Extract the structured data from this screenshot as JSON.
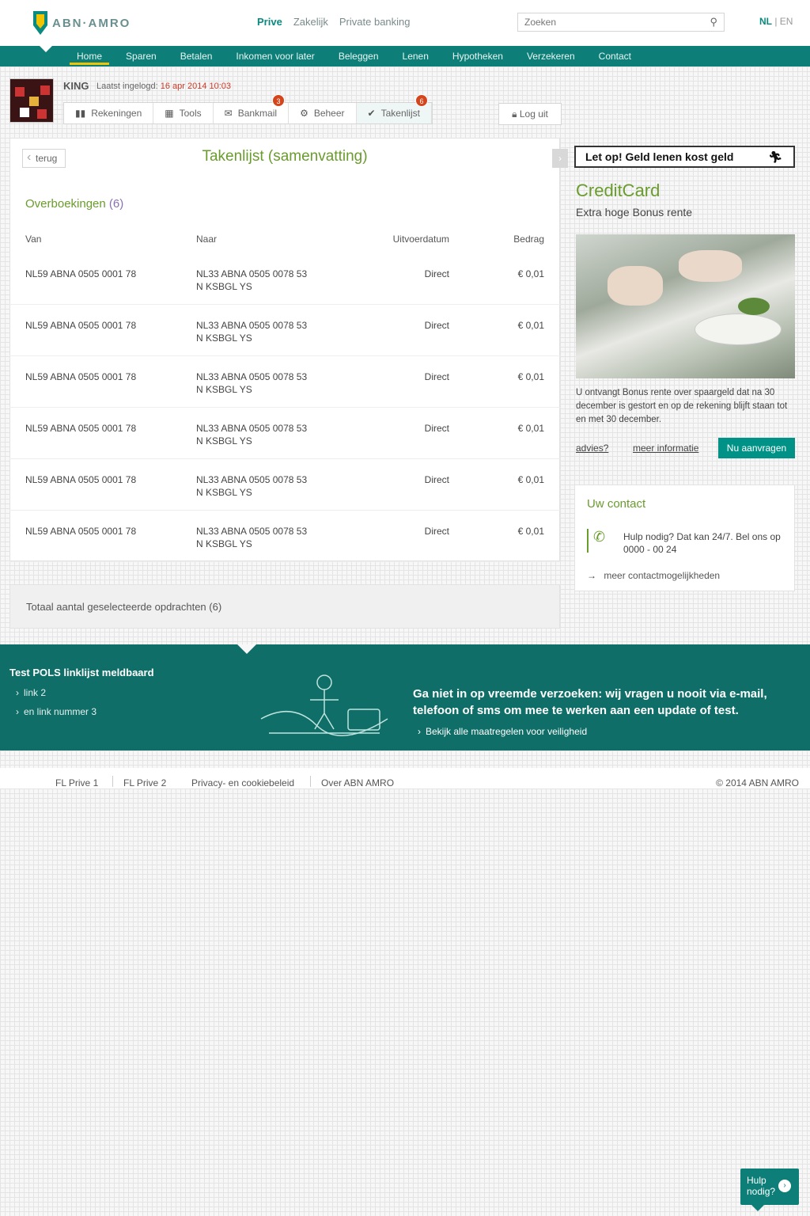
{
  "header": {
    "brand": "ABN·AMRO",
    "segments": [
      {
        "label": "Prive",
        "active": true
      },
      {
        "label": "Zakelijk",
        "active": false
      },
      {
        "label": "Private banking",
        "active": false
      }
    ],
    "search_placeholder": "Zoeken",
    "lang_active": "NL",
    "lang_other": "EN"
  },
  "mainnav": {
    "items": [
      "Home",
      "Sparen",
      "Betalen",
      "Inkomen voor later",
      "Beleggen",
      "Lenen",
      "Hypotheken",
      "Verzekeren",
      "Contact"
    ],
    "active_index": 0
  },
  "user": {
    "name": "KING",
    "last_login_label": "Laatst ingelogd:",
    "last_login_date": "16 apr 2014",
    "last_login_time": "10:03"
  },
  "tabs": [
    {
      "label": "Rekeningen",
      "icon": "bar-chart-icon",
      "glyph": "▮▮"
    },
    {
      "label": "Tools",
      "icon": "grid-icon",
      "glyph": "▦"
    },
    {
      "label": "Bankmail",
      "icon": "mail-icon",
      "glyph": "✉",
      "badge": "3"
    },
    {
      "label": "Beheer",
      "icon": "settings-icon",
      "glyph": "⚙"
    },
    {
      "label": "Takenlijst",
      "icon": "check-icon",
      "glyph": "✔",
      "badge": "6",
      "active": true
    }
  ],
  "logout": "Log uit",
  "content": {
    "back": "terug",
    "title": "Takenlijst (samenvatting)",
    "section": "Overboekingen",
    "section_count": "(6)",
    "columns": {
      "from": "Van",
      "to": "Naar",
      "date": "Uitvoerdatum",
      "amount": "Bedrag"
    },
    "rows": [
      {
        "from": "NL59 ABNA 0505 0001 78",
        "to": "NL33 ABNA 0505 0078 53",
        "to_name": "N KSBGL YS",
        "date": "Direct",
        "amount": "€ 0,01"
      },
      {
        "from": "NL59 ABNA 0505 0001 78",
        "to": "NL33 ABNA 0505 0078 53",
        "to_name": "N KSBGL YS",
        "date": "Direct",
        "amount": "€ 0,01"
      },
      {
        "from": "NL59 ABNA 0505 0001 78",
        "to": "NL33 ABNA 0505 0078 53",
        "to_name": "N KSBGL YS",
        "date": "Direct",
        "amount": "€ 0,01"
      },
      {
        "from": "NL59 ABNA 0505 0001 78",
        "to": "NL33 ABNA 0505 0078 53",
        "to_name": "N KSBGL YS",
        "date": "Direct",
        "amount": "€ 0,01"
      },
      {
        "from": "NL59 ABNA 0505 0001 78",
        "to": "NL33 ABNA 0505 0078 53",
        "to_name": "N KSBGL YS",
        "date": "Direct",
        "amount": "€ 0,01"
      },
      {
        "from": "NL59 ABNA 0505 0001 78",
        "to": "NL33 ABNA 0505 0078 53",
        "to_name": "N KSBGL YS",
        "date": "Direct",
        "amount": "€ 0,01"
      }
    ],
    "selected_total": "Totaal aantal geselecteerde opdrachten (6)"
  },
  "sidebar": {
    "banner": "Let op! Geld lenen kost geld",
    "cc_title": "CreditCard",
    "cc_subtitle": "Extra hoge Bonus rente",
    "cc_text": "U ontvangt Bonus rente over spaargeld dat na 30 december is gestort en op de rekening blijft staan tot en met 30 december.",
    "cc_advies": "advies?",
    "cc_meer": "meer informatie",
    "cc_aanvragen": "Nu aanvragen",
    "contact_title": "Uw contact",
    "contact_text": "Hulp nodig? Dat kan 24/7. Bel ons op 0000 - 00 24",
    "contact_more": "meer contactmogelijkheden"
  },
  "footer": {
    "title": "Test POLS linklijst meldbaard",
    "links": [
      "link 2",
      "en link nummer 3"
    ],
    "warning": "Ga niet in op vreemde verzoeken: wij vragen u nooit via e-mail, telefoon of sms om mee te werken aan een update of test.",
    "warning_link": "Bekijk alle maatregelen voor veiligheid"
  },
  "legal": {
    "links": [
      "FL Prive 1",
      "FL Prive 2",
      "Privacy- en cookiebeleid",
      "Over ABN AMRO"
    ],
    "copyright": "© 2014 ABN AMRO"
  },
  "help": {
    "line1": "Hulp",
    "line2": "nodig?"
  },
  "colors": {
    "brand_teal": "#0d7f78",
    "accent_green": "#6a9c2d",
    "badge_red": "#d4451c",
    "nav_yellow": "#f0c400"
  }
}
